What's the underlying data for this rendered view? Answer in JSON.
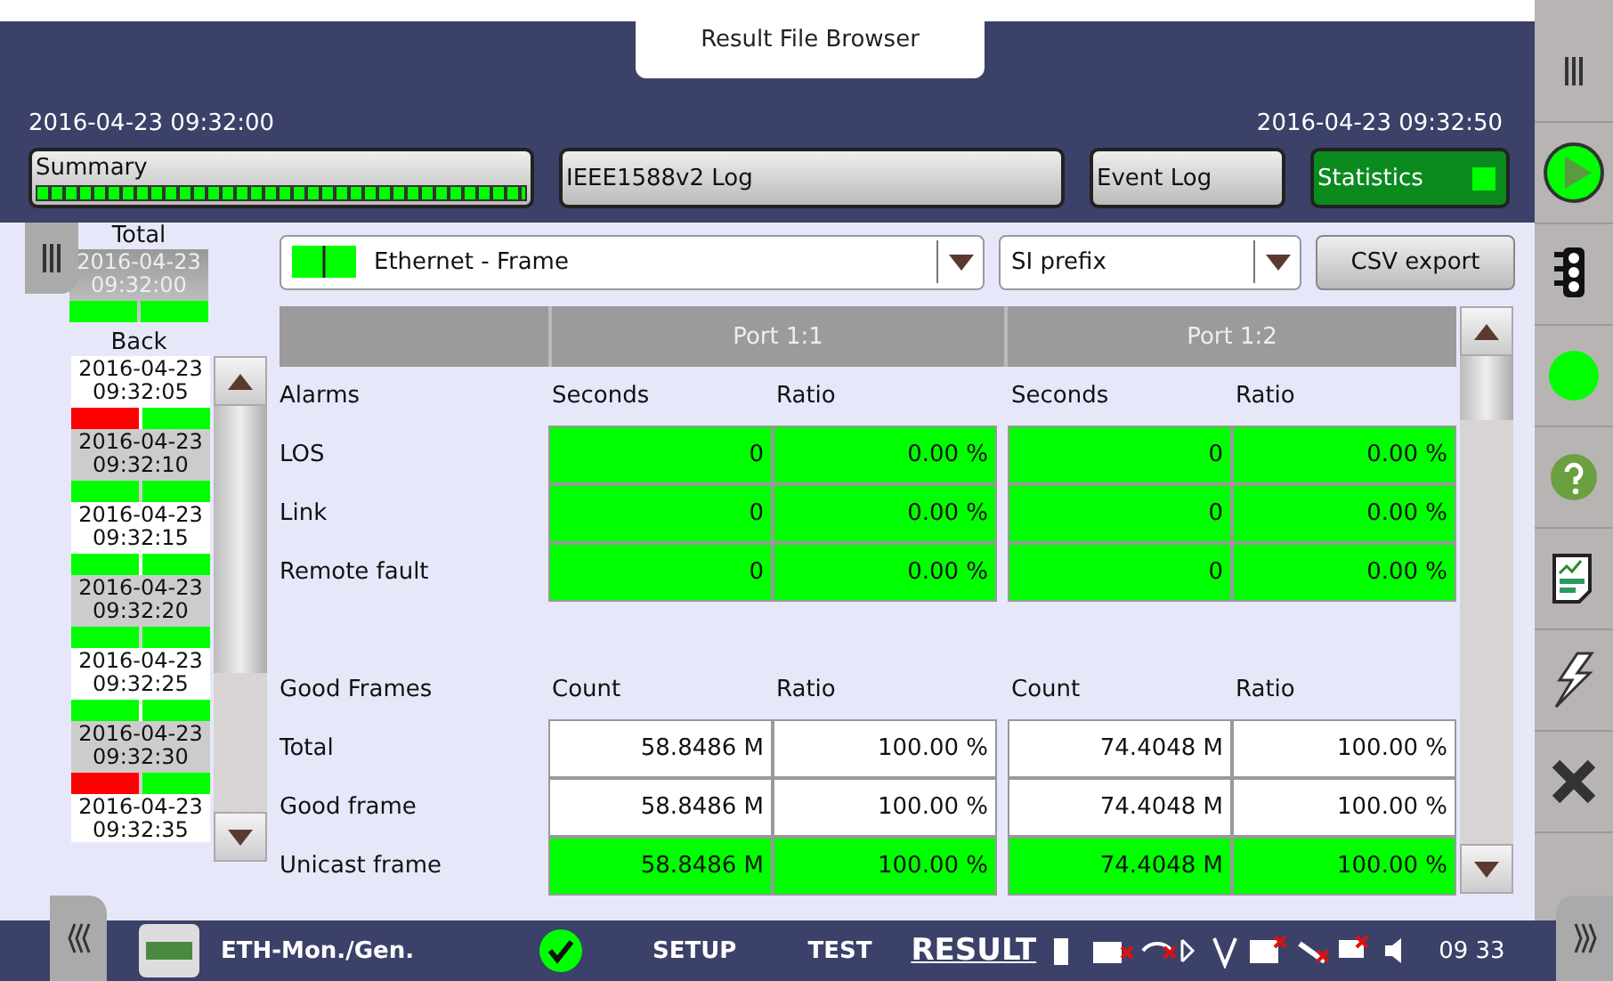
{
  "window": {
    "title": "Result File Browser"
  },
  "time_range": {
    "start": "2016-04-23 09:32:00",
    "end": "2016-04-23 09:32:50"
  },
  "tabs": [
    {
      "label": "Summary",
      "kind": "progress",
      "level": 1,
      "selected": false
    },
    {
      "label": "IEEE1588v2 Log",
      "kind": "plain",
      "selected": false
    },
    {
      "label": "Event Log",
      "kind": "plain",
      "selected": false
    },
    {
      "label": "Statistics",
      "kind": "plain",
      "selected": true
    }
  ],
  "history": {
    "total": {
      "label": "Total",
      "date": "2016-04-23",
      "time": "09:32:00",
      "ports": [
        {
          "color": "#00ff00"
        },
        {
          "color": "#00ff00"
        }
      ]
    },
    "back_label": "Back",
    "entries": [
      {
        "date": "2016-04-23",
        "time": "09:32:05",
        "ports": [
          {
            "color": "#ff0000"
          },
          {
            "color": "#00ff00"
          }
        ]
      },
      {
        "date": "2016-04-23",
        "time": "09:32:10",
        "ports": [
          {
            "color": "#00ff00"
          },
          {
            "color": "#00ff00"
          }
        ]
      },
      {
        "date": "2016-04-23",
        "time": "09:32:15",
        "ports": [
          {
            "color": "#00ff00"
          },
          {
            "color": "#00ff00"
          }
        ]
      },
      {
        "date": "2016-04-23",
        "time": "09:32:20",
        "ports": [
          {
            "color": "#00ff00"
          },
          {
            "color": "#00ff00"
          }
        ]
      },
      {
        "date": "2016-04-23",
        "time": "09:32:25",
        "ports": [
          {
            "color": "#00ff00"
          },
          {
            "color": "#00ff00"
          }
        ]
      },
      {
        "date": "2016-04-23",
        "time": "09:32:30",
        "ports": [
          {
            "color": "#ff0000"
          },
          {
            "color": "#00ff00"
          }
        ]
      },
      {
        "date": "2016-04-23",
        "time": "09:32:35"
      }
    ]
  },
  "controls": {
    "category": {
      "value": "Ethernet - Frame"
    },
    "units": {
      "value": "SI prefix"
    },
    "export_button": "CSV export"
  },
  "table": {
    "ports": [
      "Port 1:1",
      "Port 1:2"
    ],
    "sections": [
      {
        "title": "Alarms",
        "columns": [
          "Seconds",
          "Ratio",
          "Seconds",
          "Ratio"
        ],
        "rows": [
          {
            "label": "LOS",
            "cells": [
              {
                "value": "0",
                "color": "#00ff00"
              },
              {
                "value": "0.00 %",
                "color": "#00ff00"
              },
              {
                "value": "0",
                "color": "#00ff00"
              },
              {
                "value": "0.00 %",
                "color": "#00ff00"
              }
            ]
          },
          {
            "label": "Link",
            "cells": [
              {
                "value": "0",
                "color": "#00ff00"
              },
              {
                "value": "0.00 %",
                "color": "#00ff00"
              },
              {
                "value": "0",
                "color": "#00ff00"
              },
              {
                "value": "0.00 %",
                "color": "#00ff00"
              }
            ]
          },
          {
            "label": "Remote fault",
            "cells": [
              {
                "value": "0",
                "color": "#00ff00"
              },
              {
                "value": "0.00 %",
                "color": "#00ff00"
              },
              {
                "value": "0",
                "color": "#00ff00"
              },
              {
                "value": "0.00 %",
                "color": "#00ff00"
              }
            ]
          }
        ]
      },
      {
        "title": "Good Frames",
        "columns": [
          "Count",
          "Ratio",
          "Count",
          "Ratio"
        ],
        "rows": [
          {
            "label": "Total",
            "cells": [
              {
                "value": "58.8486 M",
                "color": "#ffffff"
              },
              {
                "value": "100.00 %",
                "color": "#ffffff"
              },
              {
                "value": "74.4048 M",
                "color": "#ffffff"
              },
              {
                "value": "100.00 %",
                "color": "#ffffff"
              }
            ]
          },
          {
            "label": "Good frame",
            "cells": [
              {
                "value": "58.8486 M",
                "color": "#ffffff"
              },
              {
                "value": "100.00 %",
                "color": "#ffffff"
              },
              {
                "value": "74.4048 M",
                "color": "#ffffff"
              },
              {
                "value": "100.00 %",
                "color": "#ffffff"
              }
            ]
          },
          {
            "label": "Unicast frame",
            "cells": [
              {
                "value": "58.8486 M",
                "color": "#00ff00"
              },
              {
                "value": "100.00 %",
                "color": "#00ff00"
              },
              {
                "value": "74.4048 M",
                "color": "#00ff00"
              },
              {
                "value": "100.00 %",
                "color": "#00ff00"
              }
            ]
          }
        ]
      }
    ]
  },
  "status_bar": {
    "app": "ETH-Mon./Gen.",
    "nav": [
      {
        "label": "SETUP",
        "selected": false
      },
      {
        "label": "TEST",
        "selected": false
      },
      {
        "label": "RESULT",
        "selected": true
      }
    ],
    "clock": "09 33"
  }
}
